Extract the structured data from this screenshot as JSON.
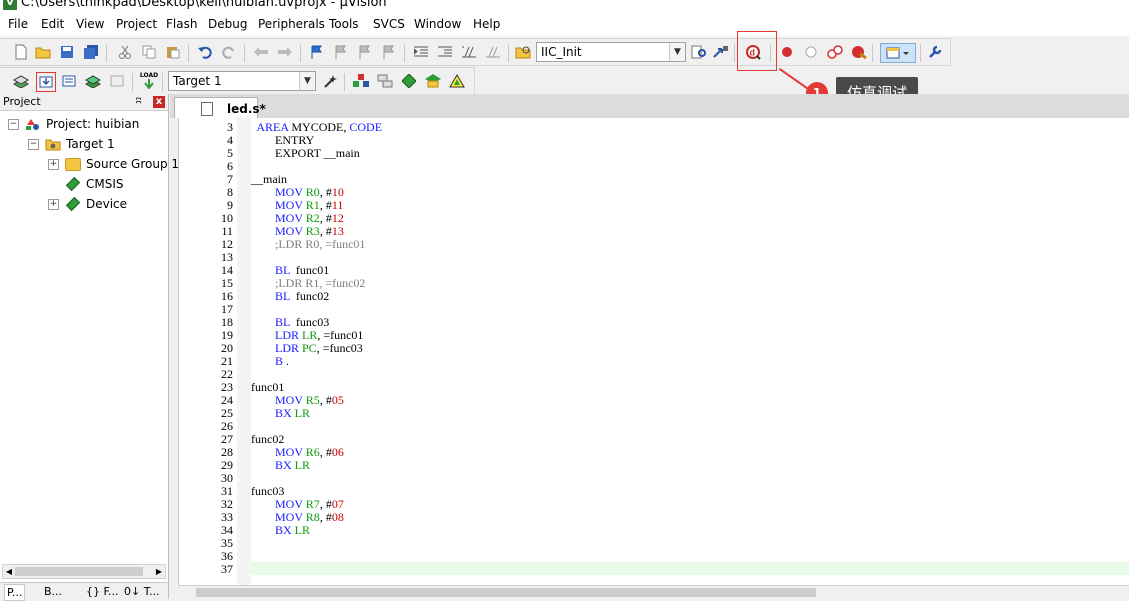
{
  "window": {
    "title": "C:\\Users\\thinkpad\\Desktop\\keil\\huibian.uvprojx - µVision"
  },
  "menu": [
    "File",
    "Edit",
    "View",
    "Project",
    "Flash",
    "Debug",
    "Peripherals",
    "Tools",
    "SVCS",
    "Window",
    "Help"
  ],
  "toolbar1": {
    "function_combo": "IIC_Init"
  },
  "toolbar2": {
    "target_combo": "Target 1",
    "load_label": "LOAD"
  },
  "annotation": {
    "badge": "1",
    "tooltip": "仿真调试"
  },
  "project_panel": {
    "title": "Project",
    "pin": "ʭ",
    "close": "x",
    "tree": [
      {
        "label": "Project: huibian",
        "expander": "−"
      },
      {
        "label": "Target 1",
        "expander": "−"
      },
      {
        "label": "Source Group 1",
        "expander": "+"
      },
      {
        "label": "CMSIS",
        "expander": ""
      },
      {
        "label": "Device",
        "expander": "+"
      }
    ],
    "bottom_tabs": [
      "P...",
      "B...",
      "{} F...",
      "0↓ T..."
    ]
  },
  "editor": {
    "tab": "led.s*",
    "lines": [
      {
        "n": "3",
        "t": [
          [
            "  ",
            ""
          ],
          [
            "AREA",
            "kw"
          ],
          [
            " MYCODE, ",
            ""
          ],
          [
            "CODE",
            "kw"
          ]
        ]
      },
      {
        "n": "4",
        "t": [
          [
            "        ENTRY",
            ""
          ]
        ]
      },
      {
        "n": "5",
        "t": [
          [
            "        EXPORT __main",
            ""
          ]
        ]
      },
      {
        "n": "6",
        "t": [
          [
            "",
            ""
          ]
        ]
      },
      {
        "n": "7",
        "t": [
          [
            "__main",
            ""
          ]
        ]
      },
      {
        "n": "8",
        "t": [
          [
            "        ",
            ""
          ],
          [
            "MOV",
            "kw"
          ],
          [
            " ",
            ""
          ],
          [
            "R0",
            "reg"
          ],
          [
            ", #",
            ""
          ],
          [
            "10",
            "num"
          ]
        ]
      },
      {
        "n": "9",
        "t": [
          [
            "        ",
            ""
          ],
          [
            "MOV",
            "kw"
          ],
          [
            " ",
            ""
          ],
          [
            "R1",
            "reg"
          ],
          [
            ", #",
            ""
          ],
          [
            "11",
            "num"
          ]
        ]
      },
      {
        "n": "10",
        "t": [
          [
            "        ",
            ""
          ],
          [
            "MOV",
            "kw"
          ],
          [
            " ",
            ""
          ],
          [
            "R2",
            "reg"
          ],
          [
            ", #",
            ""
          ],
          [
            "12",
            "num"
          ]
        ]
      },
      {
        "n": "11",
        "t": [
          [
            "        ",
            ""
          ],
          [
            "MOV",
            "kw"
          ],
          [
            " ",
            ""
          ],
          [
            "R3",
            "reg"
          ],
          [
            ", #",
            ""
          ],
          [
            "13",
            "num"
          ]
        ]
      },
      {
        "n": "12",
        "t": [
          [
            "        ",
            ""
          ],
          [
            ";LDR R0, =func01",
            "cmt"
          ]
        ]
      },
      {
        "n": "13",
        "t": [
          [
            "",
            ""
          ]
        ]
      },
      {
        "n": "14",
        "t": [
          [
            "        ",
            ""
          ],
          [
            "BL",
            "kw"
          ],
          [
            "  func01",
            ""
          ]
        ]
      },
      {
        "n": "15",
        "t": [
          [
            "        ",
            ""
          ],
          [
            ";LDR R1, =func02",
            "cmt"
          ]
        ]
      },
      {
        "n": "16",
        "t": [
          [
            "        ",
            ""
          ],
          [
            "BL",
            "kw"
          ],
          [
            "  func02",
            ""
          ]
        ]
      },
      {
        "n": "17",
        "t": [
          [
            "",
            ""
          ]
        ]
      },
      {
        "n": "18",
        "t": [
          [
            "        ",
            ""
          ],
          [
            "BL",
            "kw"
          ],
          [
            "  func03",
            ""
          ]
        ]
      },
      {
        "n": "19",
        "t": [
          [
            "        ",
            ""
          ],
          [
            "LDR",
            "kw"
          ],
          [
            " ",
            ""
          ],
          [
            "LR",
            "reg"
          ],
          [
            ", =func01",
            ""
          ]
        ]
      },
      {
        "n": "20",
        "t": [
          [
            "        ",
            ""
          ],
          [
            "LDR",
            "kw"
          ],
          [
            " ",
            ""
          ],
          [
            "PC",
            "reg"
          ],
          [
            ", =func03",
            ""
          ]
        ]
      },
      {
        "n": "21",
        "t": [
          [
            "        ",
            ""
          ],
          [
            "B",
            "kw"
          ],
          [
            " .",
            ""
          ]
        ]
      },
      {
        "n": "22",
        "t": [
          [
            "",
            ""
          ]
        ]
      },
      {
        "n": "23",
        "t": [
          [
            "func01",
            ""
          ]
        ]
      },
      {
        "n": "24",
        "t": [
          [
            "        ",
            ""
          ],
          [
            "MOV",
            "kw"
          ],
          [
            " ",
            ""
          ],
          [
            "R5",
            "reg"
          ],
          [
            ", #",
            ""
          ],
          [
            "05",
            "num"
          ]
        ]
      },
      {
        "n": "25",
        "t": [
          [
            "        ",
            ""
          ],
          [
            "BX",
            "kw"
          ],
          [
            " ",
            ""
          ],
          [
            "LR",
            "reg"
          ]
        ]
      },
      {
        "n": "26",
        "t": [
          [
            "",
            ""
          ]
        ]
      },
      {
        "n": "27",
        "t": [
          [
            "func02",
            ""
          ]
        ]
      },
      {
        "n": "28",
        "t": [
          [
            "        ",
            ""
          ],
          [
            "MOV",
            "kw"
          ],
          [
            " ",
            ""
          ],
          [
            "R6",
            "reg"
          ],
          [
            ", #",
            ""
          ],
          [
            "06",
            "num"
          ]
        ]
      },
      {
        "n": "29",
        "t": [
          [
            "        ",
            ""
          ],
          [
            "BX",
            "kw"
          ],
          [
            " ",
            ""
          ],
          [
            "LR",
            "reg"
          ]
        ]
      },
      {
        "n": "30",
        "t": [
          [
            "",
            ""
          ]
        ]
      },
      {
        "n": "31",
        "t": [
          [
            "func03",
            ""
          ]
        ]
      },
      {
        "n": "32",
        "t": [
          [
            "        ",
            ""
          ],
          [
            "MOV",
            "kw"
          ],
          [
            " ",
            ""
          ],
          [
            "R7",
            "reg"
          ],
          [
            ", #",
            ""
          ],
          [
            "07",
            "num"
          ]
        ]
      },
      {
        "n": "33",
        "t": [
          [
            "        ",
            ""
          ],
          [
            "MOV",
            "kw"
          ],
          [
            " ",
            ""
          ],
          [
            "R8",
            "reg"
          ],
          [
            ", #",
            ""
          ],
          [
            "08",
            "num"
          ]
        ]
      },
      {
        "n": "34",
        "t": [
          [
            "        ",
            ""
          ],
          [
            "BX",
            "kw"
          ],
          [
            " ",
            ""
          ],
          [
            "LR",
            "reg"
          ]
        ]
      },
      {
        "n": "35",
        "t": [
          [
            "",
            ""
          ]
        ]
      },
      {
        "n": "36",
        "t": [
          [
            "",
            ""
          ]
        ]
      },
      {
        "n": "37",
        "t": [
          [
            "",
            ""
          ]
        ]
      }
    ]
  },
  "colors": {
    "accent_red": "#e53935",
    "keyword": "#1a1aff",
    "register": "#0a9a0a",
    "number": "#cc0000",
    "comment": "#808080"
  }
}
